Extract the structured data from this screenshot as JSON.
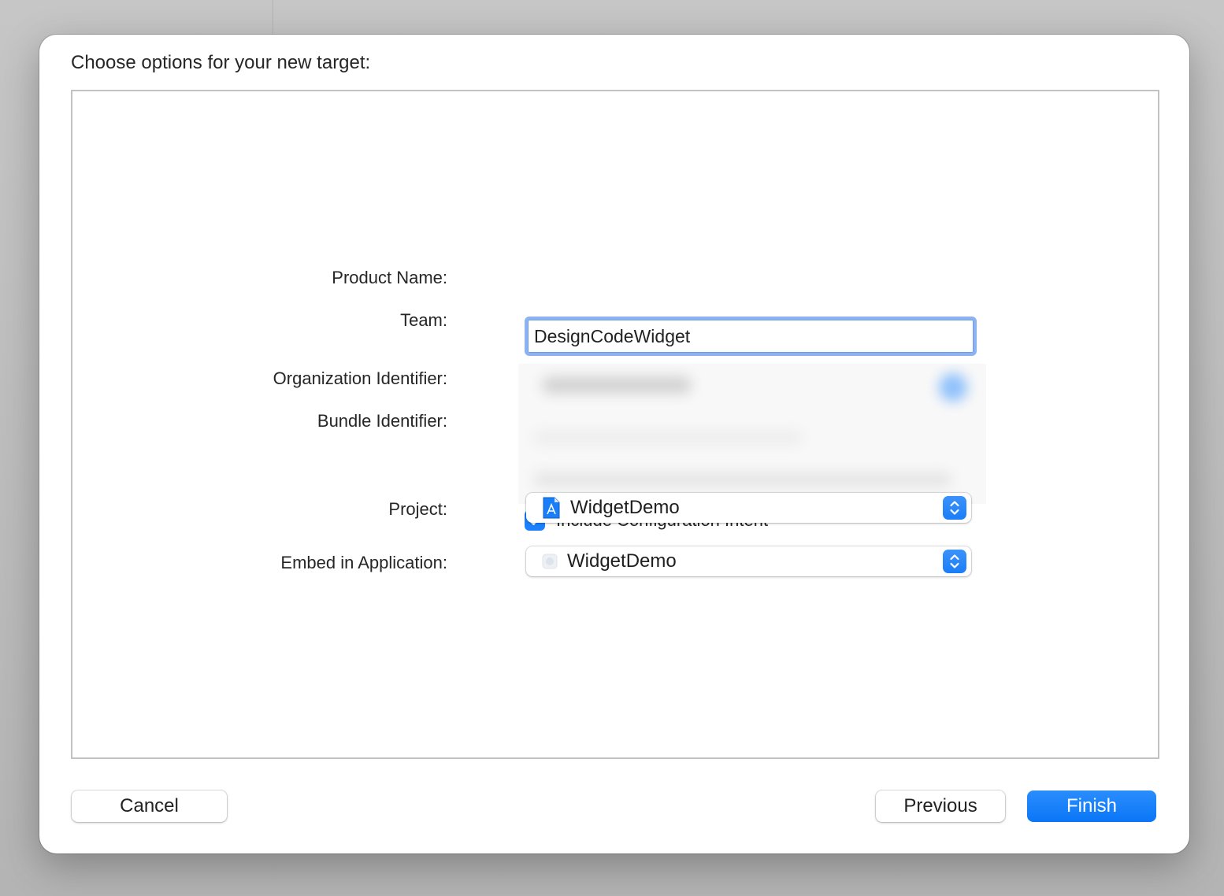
{
  "dialog": {
    "title": "Choose options for your new target:"
  },
  "form": {
    "product_name": {
      "label": "Product Name:",
      "value": "DesignCodeWidget"
    },
    "team": {
      "label": "Team:"
    },
    "organization_identifier": {
      "label": "Organization Identifier:"
    },
    "bundle_identifier": {
      "label": "Bundle Identifier:"
    },
    "include_configuration_intent": {
      "label": "Include Configuration Intent",
      "checked": true
    },
    "project": {
      "label": "Project:",
      "value": "WidgetDemo",
      "icon": "xcode-project-icon"
    },
    "embed_in_application": {
      "label": "Embed in Application:",
      "value": "WidgetDemo",
      "icon": "app-icon"
    }
  },
  "buttons": {
    "cancel": "Cancel",
    "previous": "Previous",
    "finish": "Finish"
  },
  "colors": {
    "accent": "#0a76f7",
    "focus_ring": "#8cb2f2"
  }
}
